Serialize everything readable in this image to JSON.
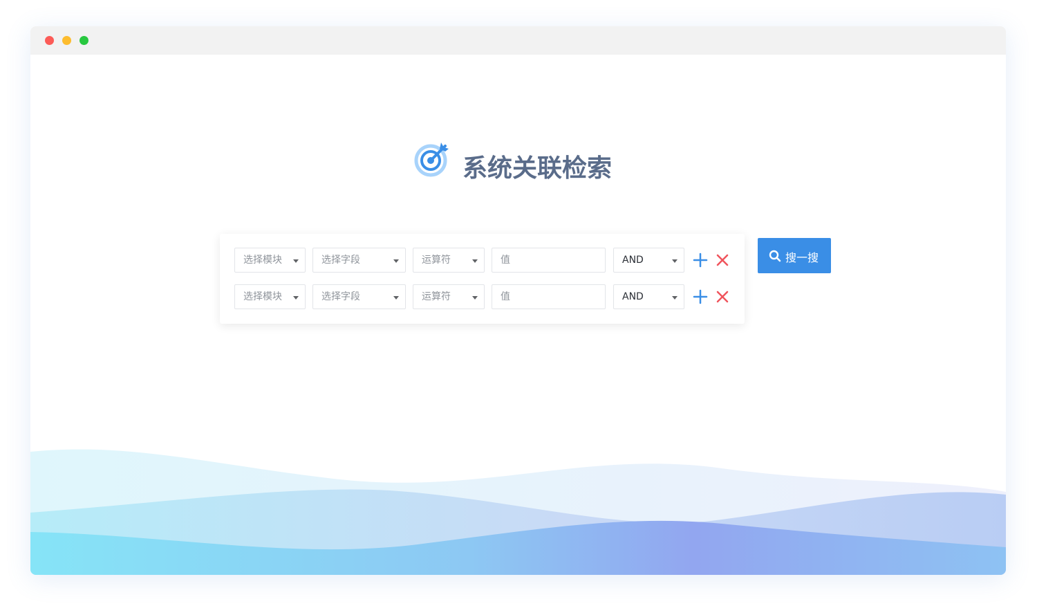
{
  "window": {
    "controls": [
      "close",
      "minimize",
      "maximize"
    ]
  },
  "header": {
    "title": "系统关联检索",
    "logo_icon": "target-arrow-icon"
  },
  "query": {
    "rows": [
      {
        "module_placeholder": "选择模块",
        "field_placeholder": "选择字段",
        "operator_placeholder": "运算符",
        "value_placeholder": "值",
        "logic_value": "AND"
      },
      {
        "module_placeholder": "选择模块",
        "field_placeholder": "选择字段",
        "operator_placeholder": "运算符",
        "value_placeholder": "值",
        "logic_value": "AND"
      }
    ],
    "add_icon": "plus-icon",
    "remove_icon": "close-icon"
  },
  "search": {
    "label": "搜一搜",
    "icon": "search-icon"
  },
  "colors": {
    "accent": "#3a8ee6",
    "title": "#5a6c8a",
    "add": "#3a8ee6",
    "remove": "#f0545c",
    "titlebar": "#f2f2f2"
  }
}
